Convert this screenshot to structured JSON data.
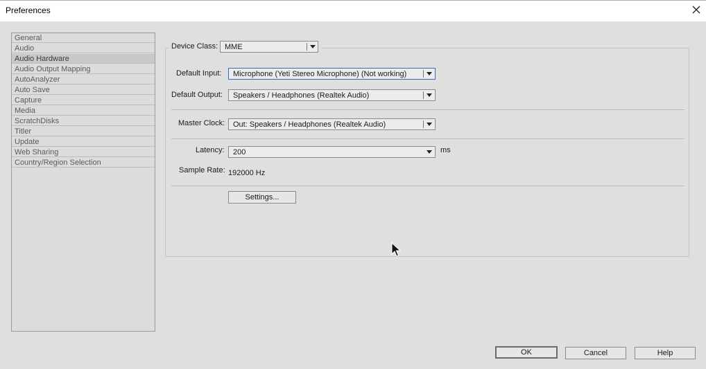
{
  "window": {
    "title": "Preferences"
  },
  "sidebar": {
    "items": [
      {
        "label": "General"
      },
      {
        "label": "Audio"
      },
      {
        "label": "Audio Hardware",
        "selected": true
      },
      {
        "label": "Audio Output Mapping"
      },
      {
        "label": "AutoAnalyzer"
      },
      {
        "label": "Auto Save"
      },
      {
        "label": "Capture"
      },
      {
        "label": "Media"
      },
      {
        "label": "ScratchDisks"
      },
      {
        "label": "Titler"
      },
      {
        "label": "Update"
      },
      {
        "label": "Web Sharing"
      },
      {
        "label": "Country/Region Selection"
      }
    ]
  },
  "audio_hardware": {
    "device_class": {
      "label": "Device Class:",
      "value": "MME"
    },
    "default_input": {
      "label": "Default Input:",
      "value": "Microphone (Yeti Stereo Microphone) (Not working)"
    },
    "default_output": {
      "label": "Default Output:",
      "value": "Speakers / Headphones (Realtek Audio)"
    },
    "master_clock": {
      "label": "Master Clock:",
      "value": "Out: Speakers / Headphones (Realtek Audio)"
    },
    "latency": {
      "label": "Latency:",
      "value": "200",
      "unit": "ms"
    },
    "sample_rate": {
      "label": "Sample Rate:",
      "value": "192000 Hz"
    },
    "settings_label": "Settings..."
  },
  "footer": {
    "ok_label": "OK",
    "cancel_label": "Cancel",
    "help_label": "Help"
  },
  "colors": {
    "focus_border": "#2a6ebb",
    "selected_row": "#c8c8c8"
  }
}
